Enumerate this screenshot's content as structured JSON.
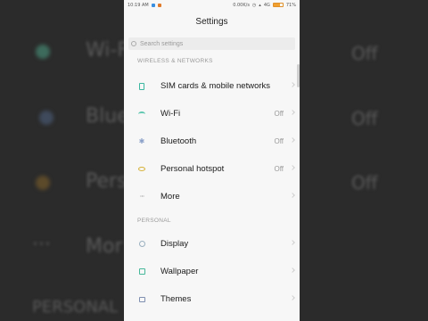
{
  "status_bar": {
    "time": "10:19 AM",
    "network_speed": "0.00K/s",
    "network_type": "4G",
    "battery": "71%"
  },
  "header": {
    "title": "Settings"
  },
  "search": {
    "placeholder": "Search settings"
  },
  "sections": {
    "wireless": "WIRELESS & NETWORKS",
    "personal": "PERSONAL"
  },
  "items": {
    "sim": {
      "label": "SIM cards & mobile networks",
      "icon": "sim-card-icon"
    },
    "wifi": {
      "label": "Wi-Fi",
      "value": "Off",
      "icon": "wifi-icon"
    },
    "bluetooth": {
      "label": "Bluetooth",
      "value": "Off",
      "icon": "bluetooth-icon"
    },
    "hotspot": {
      "label": "Personal hotspot",
      "value": "Off",
      "icon": "hotspot-icon"
    },
    "more": {
      "label": "More",
      "icon": "more-icon"
    },
    "display": {
      "label": "Display",
      "icon": "display-icon"
    },
    "wallpaper": {
      "label": "Wallpaper",
      "icon": "wallpaper-icon"
    },
    "themes": {
      "label": "Themes",
      "icon": "themes-icon"
    }
  },
  "background": {
    "wifi": "Wi-F",
    "bluetooth": "Blue",
    "hotspot": "Pers",
    "more": "Mor",
    "personal": "PERSONAL",
    "off": "Off"
  },
  "colors": {
    "accent_green": "#3bb7a0",
    "hotspot_yellow": "#d6b23a",
    "battery_orange": "#f0a030"
  }
}
